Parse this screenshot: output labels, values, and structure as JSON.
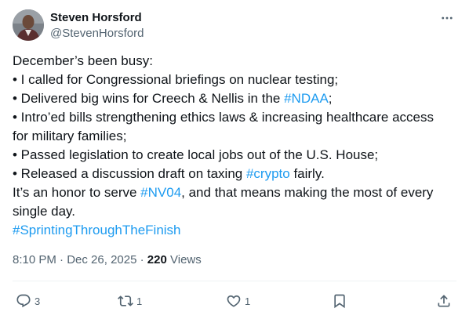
{
  "author": {
    "display_name": "Steven Horsford",
    "handle": "@StevenHorsford"
  },
  "tweet": {
    "lines": [
      [
        {
          "t": "December’s been busy:"
        }
      ],
      [
        {
          "t": "• I called for Congressional briefings on nuclear testing;"
        }
      ],
      [
        {
          "t": "• Delivered big wins for Creech & Nellis in the "
        },
        {
          "t": "#NDAA",
          "tag": true
        },
        {
          "t": ";"
        }
      ],
      [
        {
          "t": "• Intro’ed bills strengthening ethics laws & increasing healthcare access"
        }
      ],
      [
        {
          "t": "for military families;"
        }
      ],
      [
        {
          "t": "• Passed legislation to create local jobs out of the U.S. House;"
        }
      ],
      [
        {
          "t": "• Released a discussion draft on taxing "
        },
        {
          "t": "#crypto",
          "tag": true
        },
        {
          "t": " fairly."
        }
      ],
      [
        {
          "t": "It’s an honor to serve "
        },
        {
          "t": "#NV04",
          "tag": true
        },
        {
          "t": ", and that means making the most of every"
        }
      ],
      [
        {
          "t": "single day."
        }
      ],
      [
        {
          "t": "#SprintingThroughTheFinish",
          "tag": true
        }
      ]
    ]
  },
  "meta": {
    "time": "8:10 PM",
    "separator": "·",
    "date": "Dec 26, 2025",
    "views_count": "220",
    "views_label": "Views"
  },
  "actions": {
    "reply_count": "3",
    "repost_count": "1",
    "like_count": "1"
  },
  "colors": {
    "link": "#1d9bf0",
    "secondary_text": "#536471",
    "primary_text": "#0f1419",
    "divider": "#eff3f4"
  },
  "icons": [
    "more-icon",
    "reply-icon",
    "repost-icon",
    "like-icon",
    "bookmark-icon",
    "share-icon"
  ]
}
